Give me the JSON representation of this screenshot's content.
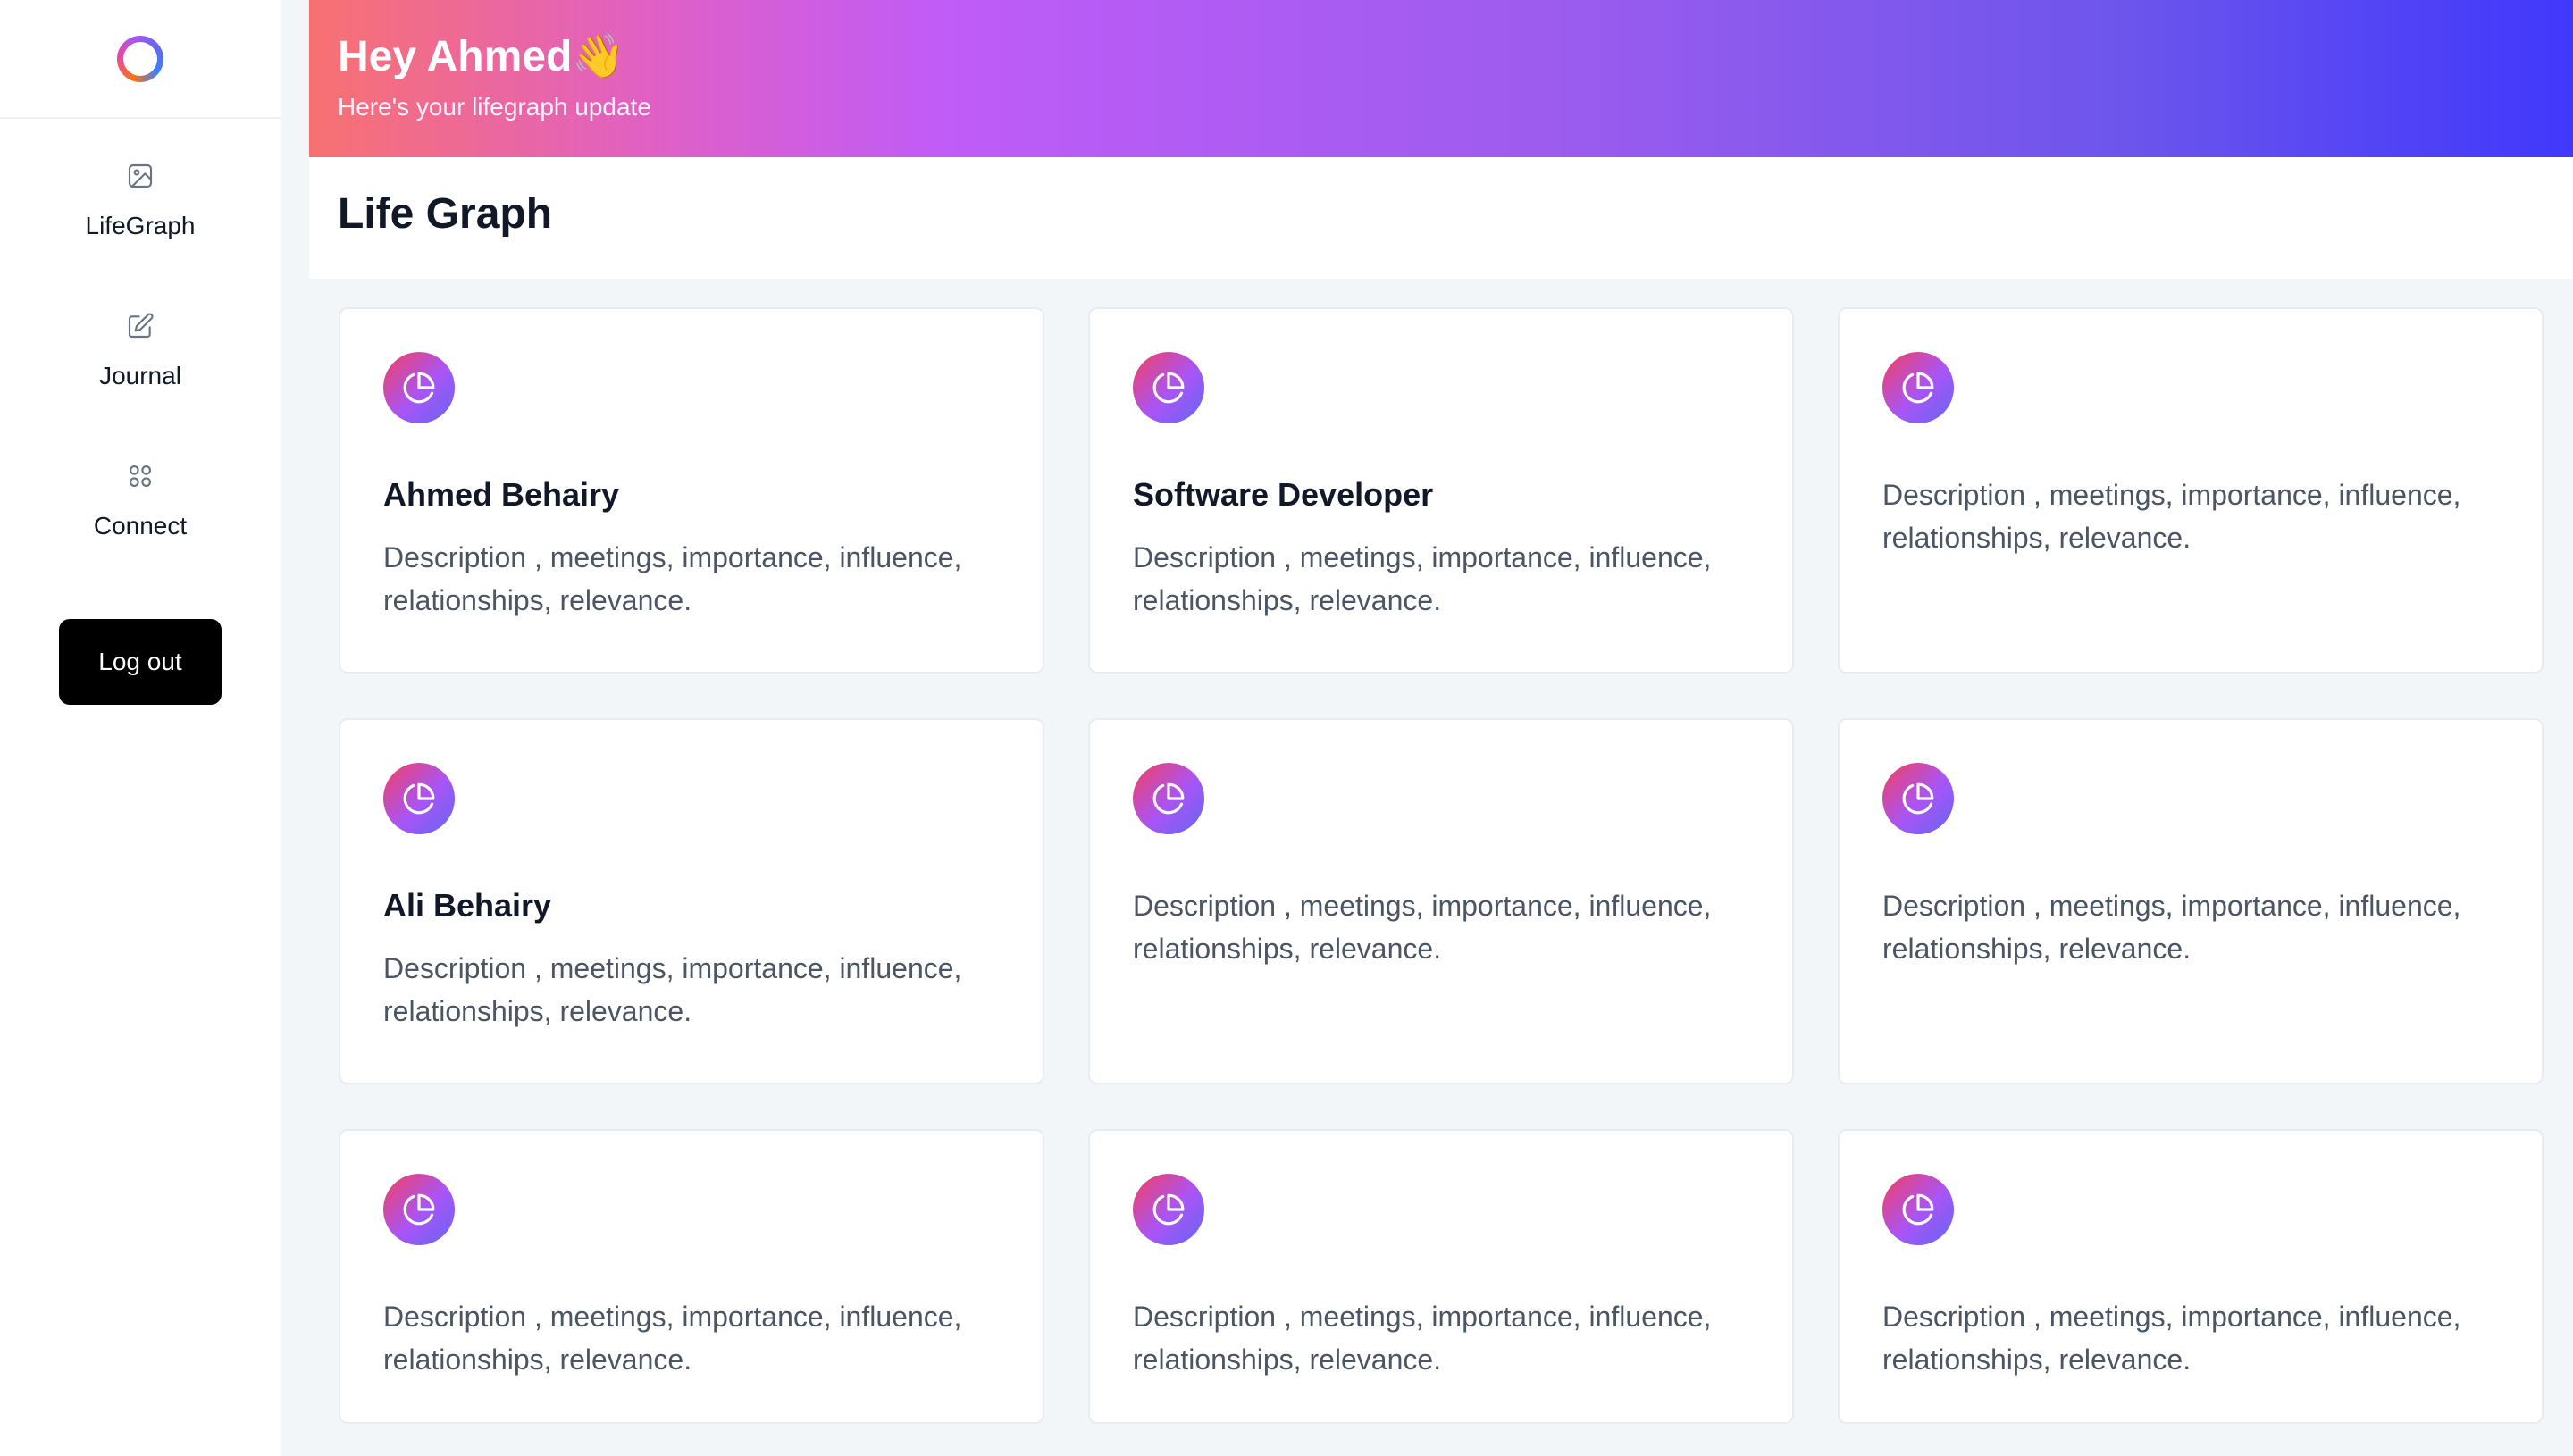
{
  "sidebar": {
    "logo": "ring-logo",
    "items": [
      {
        "label": "LifeGraph",
        "icon": "image-icon"
      },
      {
        "label": "Journal",
        "icon": "edit-icon"
      },
      {
        "label": "Connect",
        "icon": "grid-icon"
      }
    ],
    "logout_label": "Log out"
  },
  "header": {
    "greeting": "Hey Ahmed👋",
    "subtitle": "Here's your lifegraph update"
  },
  "page": {
    "title": "Life Graph"
  },
  "cards": [
    {
      "title": "Ahmed Behairy",
      "description": "Description , meetings, importance, influence, relationships, relevance.",
      "icon": "pie-chart-icon"
    },
    {
      "title": "Software Developer",
      "description": "Description , meetings, importance, influence, relationships, relevance.",
      "icon": "pie-chart-icon"
    },
    {
      "title": "",
      "description": "Description , meetings, importance, influence, relationships, relevance.",
      "icon": "pie-chart-icon"
    },
    {
      "title": "Ali Behairy",
      "description": "Description , meetings, importance, influence, relationships, relevance.",
      "icon": "pie-chart-icon"
    },
    {
      "title": "",
      "description": "Description , meetings, importance, influence, relationships, relevance.",
      "icon": "pie-chart-icon"
    },
    {
      "title": "",
      "description": "Description , meetings, importance, influence, relationships, relevance.",
      "icon": "pie-chart-icon"
    },
    {
      "title": "",
      "description": "Description , meetings, importance, influence, relationships, relevance.",
      "icon": "pie-chart-icon"
    },
    {
      "title": "",
      "description": "Description , meetings, importance, influence, relationships, relevance.",
      "icon": "pie-chart-icon"
    },
    {
      "title": "",
      "description": "Description , meetings, importance, influence, relationships, relevance.",
      "icon": "pie-chart-icon"
    }
  ],
  "colors": {
    "banner_start": "#f87171",
    "banner_mid": "#c05cf8",
    "banner_end": "#4038fb",
    "logout_bg": "#000000"
  }
}
